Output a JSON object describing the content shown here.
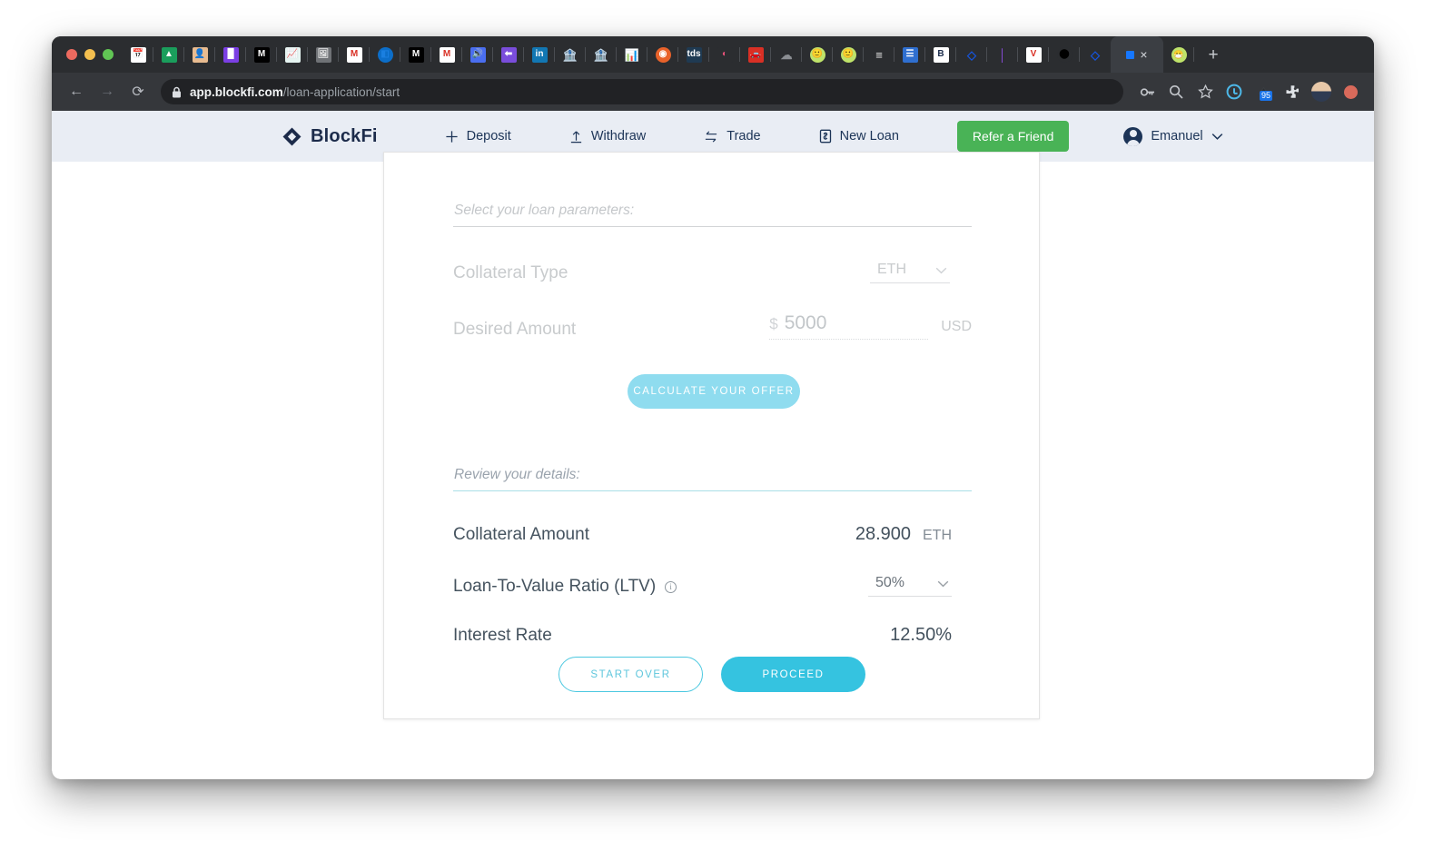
{
  "browser": {
    "traffic_lights": [
      "close",
      "minimize",
      "maximize"
    ],
    "tabs": [
      {
        "name": "pinned-tab-1",
        "icon": "calendar-icon",
        "glyph": "📅"
      },
      {
        "name": "pinned-tab-2",
        "icon": "google-drive-icon",
        "glyph": "▲"
      },
      {
        "name": "pinned-tab-3",
        "icon": "memoji-icon",
        "glyph": "👤"
      },
      {
        "name": "pinned-tab-4",
        "icon": "bookmark-icon",
        "glyph": "█"
      },
      {
        "name": "pinned-tab-5",
        "icon": "medium-icon",
        "glyph": "M"
      },
      {
        "name": "pinned-tab-6",
        "icon": "chart-icon",
        "glyph": "📈"
      },
      {
        "name": "pinned-tab-7",
        "icon": "photo-icon",
        "glyph": "🖼"
      },
      {
        "name": "pinned-tab-8",
        "icon": "gmail-icon",
        "glyph": "M"
      },
      {
        "name": "pinned-tab-9",
        "icon": "hubspot-icon",
        "glyph": "◧"
      },
      {
        "name": "pinned-tab-10",
        "icon": "medium-icon",
        "glyph": "M"
      },
      {
        "name": "pinned-tab-11",
        "icon": "gmail-icon",
        "glyph": "M"
      },
      {
        "name": "pinned-tab-12",
        "icon": "sound-icon",
        "glyph": "🔊"
      },
      {
        "name": "pinned-tab-13",
        "icon": "purple-arrow-icon",
        "glyph": "⬅"
      },
      {
        "name": "pinned-tab-14",
        "icon": "linkedin-icon",
        "glyph": "in"
      },
      {
        "name": "pinned-tab-15",
        "icon": "bank-icon",
        "glyph": "🏦"
      },
      {
        "name": "pinned-tab-16",
        "icon": "bank-icon",
        "glyph": "🏦"
      },
      {
        "name": "pinned-tab-17",
        "icon": "bar-chart-icon",
        "glyph": "📊"
      },
      {
        "name": "pinned-tab-18",
        "icon": "orange-swirl-icon",
        "glyph": "◉"
      },
      {
        "name": "pinned-tab-19",
        "icon": "tds-icon",
        "glyph": "tds"
      },
      {
        "name": "pinned-tab-20",
        "icon": "figma-icon",
        "glyph": "◐"
      },
      {
        "name": "pinned-tab-21",
        "icon": "car-icon",
        "glyph": "🚗"
      },
      {
        "name": "pinned-tab-22",
        "icon": "cloud-icon",
        "glyph": "☁"
      },
      {
        "name": "pinned-tab-23",
        "icon": "green-face-icon",
        "glyph": "🙂"
      },
      {
        "name": "pinned-tab-24",
        "icon": "green-face-icon",
        "glyph": "🙂"
      },
      {
        "name": "pinned-tab-25",
        "icon": "table-icon",
        "glyph": "≡"
      },
      {
        "name": "pinned-tab-26",
        "icon": "document-icon",
        "glyph": "☰"
      },
      {
        "name": "pinned-tab-27",
        "icon": "bitcoin-b-icon",
        "glyph": "B"
      },
      {
        "name": "pinned-tab-28",
        "icon": "blockfi-diamond-icon",
        "glyph": "◇"
      },
      {
        "name": "pinned-tab-29",
        "icon": "thermometer-icon",
        "glyph": "│"
      },
      {
        "name": "pinned-tab-30",
        "icon": "vimeo-v-icon",
        "glyph": "V"
      },
      {
        "name": "pinned-tab-31",
        "icon": "black-dot-icon",
        "glyph": "⬤"
      },
      {
        "name": "pinned-tab-32",
        "icon": "blockfi-diamond-icon",
        "glyph": "◇"
      }
    ],
    "active_tab": {
      "name": "active-tab",
      "icon": "blockfi-favicon",
      "close_label": "×"
    },
    "extra_tab": {
      "name": "trailing-tab",
      "icon": "green-mask-icon",
      "glyph": "😷"
    },
    "new_tab_label": "+",
    "back_label": "←",
    "forward_label": "→",
    "reload_label": "⟳",
    "lock_icon": "padlock-icon",
    "url": {
      "host": "app.blockfi.com",
      "path": "/loan-application/start"
    },
    "toolbar_icons": [
      {
        "name": "password-key-icon",
        "glyph": "⚷"
      },
      {
        "name": "search-icon",
        "glyph": "⚲"
      },
      {
        "name": "bookmark-star-icon",
        "glyph": "☆"
      },
      {
        "name": "extension-grammarly-icon",
        "glyph": "G"
      },
      {
        "name": "extension-badge-icon",
        "glyph": "▲",
        "badge": "95"
      },
      {
        "name": "extensions-puzzle-icon",
        "glyph": "❖"
      }
    ],
    "profile_avatar": "profile-avatar"
  },
  "app": {
    "brand": {
      "name": "BlockFi",
      "logo": "blockfi-diamond-logo"
    },
    "nav_items": [
      {
        "label": "Deposit",
        "icon": "plus-icon",
        "glyph": "+"
      },
      {
        "label": "Withdraw",
        "icon": "upload-arrow-icon",
        "glyph": "↑"
      },
      {
        "label": "Trade",
        "icon": "exchange-arrows-icon",
        "glyph": "⇆"
      },
      {
        "label": "New Loan",
        "icon": "document-dollar-icon",
        "glyph": "⌸"
      }
    ],
    "refer_button": "Refer a Friend",
    "user": {
      "name": "Emanuel",
      "chevron": "⌄"
    }
  },
  "card": {
    "params": {
      "title": "Select your loan parameters:",
      "collateral_type": {
        "label": "Collateral Type",
        "value": "ETH",
        "chevron": "⌄"
      },
      "desired_amount": {
        "label": "Desired Amount",
        "currency_symbol": "$",
        "value": "5000",
        "unit": "USD"
      },
      "calculate_button": "CALCULATE YOUR OFFER"
    },
    "review": {
      "title": "Review your details:",
      "rows": [
        {
          "label": "Collateral Amount",
          "value": "28.900",
          "unit": "ETH",
          "type": "text"
        },
        {
          "label": "Loan-To-Value Ratio (LTV)",
          "value": "50%",
          "unit": "",
          "type": "select",
          "info_icon": "info-circle-icon",
          "info_glyph": "i"
        },
        {
          "label": "Interest Rate",
          "value": "12.50%",
          "unit": "",
          "type": "text"
        }
      ],
      "start_over_button": "START OVER",
      "proceed_button": "PROCEED"
    }
  },
  "colors": {
    "accent_cyan": "#35c3e0",
    "accent_cyan_light": "#8fdcef",
    "brand_navy": "#1c3457",
    "refer_green": "#49b356",
    "app_nav_bg": "#e9edf4",
    "teal_divider": "#a9dfe6"
  }
}
